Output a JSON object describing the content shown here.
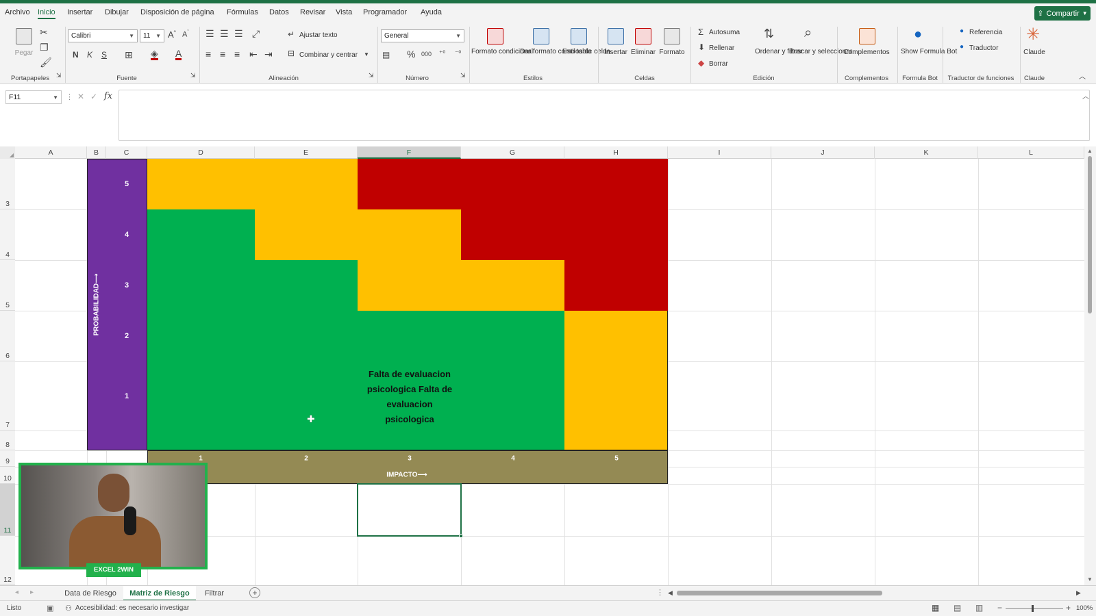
{
  "menu": {
    "tabs": [
      "Archivo",
      "Inicio",
      "Insertar",
      "Dibujar",
      "Disposición de página",
      "Fórmulas",
      "Datos",
      "Revisar",
      "Vista",
      "Programador",
      "Ayuda"
    ],
    "active_tab": "Inicio",
    "share_label": "Compartir"
  },
  "ribbon": {
    "clipboard": {
      "paste": "Pegar",
      "group": "Portapapeles"
    },
    "font": {
      "family": "Calibri",
      "size": "11",
      "bold": "N",
      "italic": "K",
      "underline": "S",
      "group": "Fuente"
    },
    "alignment": {
      "wrap": "Ajustar texto",
      "merge": "Combinar y centrar",
      "group": "Alineación"
    },
    "number": {
      "format": "General",
      "group": "Número"
    },
    "styles": {
      "conditional": "Formato condicional",
      "table": "Dar formato como tabla",
      "cell_styles": "Estilos de celda",
      "group": "Estilos"
    },
    "cells": {
      "insert": "Insertar",
      "delete": "Eliminar",
      "format": "Formato",
      "group": "Celdas"
    },
    "editing": {
      "autosum": "Autosuma",
      "fill": "Rellenar",
      "clear": "Borrar",
      "sort": "Ordenar y filtrar",
      "find": "Buscar y seleccionar",
      "group": "Edición"
    },
    "addins": {
      "label": "Complementos",
      "group": "Complementos"
    },
    "formulabot": {
      "label": "Show Formula Bot",
      "group": "Formula Bot"
    },
    "translator": {
      "reference": "Referencia",
      "translator": "Traductor",
      "group": "Traductor de funciones"
    },
    "claude": {
      "label": "Claude",
      "group": "Claude"
    }
  },
  "formula_bar": {
    "name_box": "F11",
    "fx": "fx",
    "value": ""
  },
  "grid": {
    "columns": [
      "A",
      "B",
      "C",
      "D",
      "E",
      "F",
      "G",
      "H",
      "I",
      "J",
      "K",
      "L"
    ],
    "selected_column": "F",
    "rows": [
      "3",
      "4",
      "5",
      "6",
      "7",
      "8",
      "9",
      "10",
      "11",
      "12"
    ]
  },
  "matrix": {
    "probability_axis": "PROBABILIDAD⟶",
    "impact_axis": "IMPACTO⟶",
    "probability_levels": [
      "5",
      "4",
      "3",
      "2",
      "1"
    ],
    "impact_levels": [
      "1",
      "2",
      "3",
      "4",
      "5"
    ],
    "cell_note": "Falta de evaluacion psicologica Falta de evaluacion psicologica",
    "colors": {
      "red": "#c00000",
      "yellow": "#ffc000",
      "green": "#00b050",
      "purple": "#7030a0",
      "olive": "#948a54"
    }
  },
  "sheets": {
    "tabs": [
      "Data de Riesgo",
      "Matriz de Riesgo",
      "Filtrar"
    ],
    "active": "Matriz de Riesgo"
  },
  "status": {
    "ready": "Listo",
    "accessibility": "Accesibilidad: es necesario investigar",
    "zoom": "100%"
  },
  "webcam": {
    "label": "EXCEL 2WIN"
  }
}
